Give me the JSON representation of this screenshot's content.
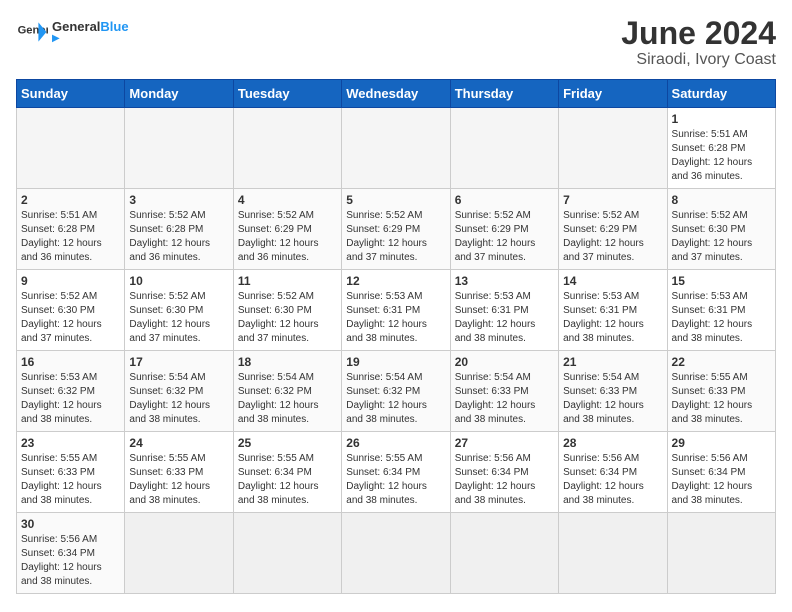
{
  "header": {
    "logo_general": "General",
    "logo_blue": "Blue",
    "title": "June 2024",
    "subtitle": "Siraodi, Ivory Coast"
  },
  "weekdays": [
    "Sunday",
    "Monday",
    "Tuesday",
    "Wednesday",
    "Thursday",
    "Friday",
    "Saturday"
  ],
  "weeks": [
    [
      {
        "day": "",
        "info": "",
        "empty": true
      },
      {
        "day": "",
        "info": "",
        "empty": true
      },
      {
        "day": "",
        "info": "",
        "empty": true
      },
      {
        "day": "",
        "info": "",
        "empty": true
      },
      {
        "day": "",
        "info": "",
        "empty": true
      },
      {
        "day": "",
        "info": "",
        "empty": true
      },
      {
        "day": "1",
        "info": "Sunrise: 5:51 AM\nSunset: 6:28 PM\nDaylight: 12 hours\nand 36 minutes.",
        "empty": false
      }
    ],
    [
      {
        "day": "2",
        "info": "Sunrise: 5:51 AM\nSunset: 6:28 PM\nDaylight: 12 hours\nand 36 minutes.",
        "empty": false
      },
      {
        "day": "3",
        "info": "Sunrise: 5:52 AM\nSunset: 6:28 PM\nDaylight: 12 hours\nand 36 minutes.",
        "empty": false
      },
      {
        "day": "4",
        "info": "Sunrise: 5:52 AM\nSunset: 6:29 PM\nDaylight: 12 hours\nand 36 minutes.",
        "empty": false
      },
      {
        "day": "5",
        "info": "Sunrise: 5:52 AM\nSunset: 6:29 PM\nDaylight: 12 hours\nand 37 minutes.",
        "empty": false
      },
      {
        "day": "6",
        "info": "Sunrise: 5:52 AM\nSunset: 6:29 PM\nDaylight: 12 hours\nand 37 minutes.",
        "empty": false
      },
      {
        "day": "7",
        "info": "Sunrise: 5:52 AM\nSunset: 6:29 PM\nDaylight: 12 hours\nand 37 minutes.",
        "empty": false
      },
      {
        "day": "8",
        "info": "Sunrise: 5:52 AM\nSunset: 6:30 PM\nDaylight: 12 hours\nand 37 minutes.",
        "empty": false
      }
    ],
    [
      {
        "day": "9",
        "info": "Sunrise: 5:52 AM\nSunset: 6:30 PM\nDaylight: 12 hours\nand 37 minutes.",
        "empty": false
      },
      {
        "day": "10",
        "info": "Sunrise: 5:52 AM\nSunset: 6:30 PM\nDaylight: 12 hours\nand 37 minutes.",
        "empty": false
      },
      {
        "day": "11",
        "info": "Sunrise: 5:52 AM\nSunset: 6:30 PM\nDaylight: 12 hours\nand 37 minutes.",
        "empty": false
      },
      {
        "day": "12",
        "info": "Sunrise: 5:53 AM\nSunset: 6:31 PM\nDaylight: 12 hours\nand 38 minutes.",
        "empty": false
      },
      {
        "day": "13",
        "info": "Sunrise: 5:53 AM\nSunset: 6:31 PM\nDaylight: 12 hours\nand 38 minutes.",
        "empty": false
      },
      {
        "day": "14",
        "info": "Sunrise: 5:53 AM\nSunset: 6:31 PM\nDaylight: 12 hours\nand 38 minutes.",
        "empty": false
      },
      {
        "day": "15",
        "info": "Sunrise: 5:53 AM\nSunset: 6:31 PM\nDaylight: 12 hours\nand 38 minutes.",
        "empty": false
      }
    ],
    [
      {
        "day": "16",
        "info": "Sunrise: 5:53 AM\nSunset: 6:32 PM\nDaylight: 12 hours\nand 38 minutes.",
        "empty": false
      },
      {
        "day": "17",
        "info": "Sunrise: 5:54 AM\nSunset: 6:32 PM\nDaylight: 12 hours\nand 38 minutes.",
        "empty": false
      },
      {
        "day": "18",
        "info": "Sunrise: 5:54 AM\nSunset: 6:32 PM\nDaylight: 12 hours\nand 38 minutes.",
        "empty": false
      },
      {
        "day": "19",
        "info": "Sunrise: 5:54 AM\nSunset: 6:32 PM\nDaylight: 12 hours\nand 38 minutes.",
        "empty": false
      },
      {
        "day": "20",
        "info": "Sunrise: 5:54 AM\nSunset: 6:33 PM\nDaylight: 12 hours\nand 38 minutes.",
        "empty": false
      },
      {
        "day": "21",
        "info": "Sunrise: 5:54 AM\nSunset: 6:33 PM\nDaylight: 12 hours\nand 38 minutes.",
        "empty": false
      },
      {
        "day": "22",
        "info": "Sunrise: 5:55 AM\nSunset: 6:33 PM\nDaylight: 12 hours\nand 38 minutes.",
        "empty": false
      }
    ],
    [
      {
        "day": "23",
        "info": "Sunrise: 5:55 AM\nSunset: 6:33 PM\nDaylight: 12 hours\nand 38 minutes.",
        "empty": false
      },
      {
        "day": "24",
        "info": "Sunrise: 5:55 AM\nSunset: 6:33 PM\nDaylight: 12 hours\nand 38 minutes.",
        "empty": false
      },
      {
        "day": "25",
        "info": "Sunrise: 5:55 AM\nSunset: 6:34 PM\nDaylight: 12 hours\nand 38 minutes.",
        "empty": false
      },
      {
        "day": "26",
        "info": "Sunrise: 5:55 AM\nSunset: 6:34 PM\nDaylight: 12 hours\nand 38 minutes.",
        "empty": false
      },
      {
        "day": "27",
        "info": "Sunrise: 5:56 AM\nSunset: 6:34 PM\nDaylight: 12 hours\nand 38 minutes.",
        "empty": false
      },
      {
        "day": "28",
        "info": "Sunrise: 5:56 AM\nSunset: 6:34 PM\nDaylight: 12 hours\nand 38 minutes.",
        "empty": false
      },
      {
        "day": "29",
        "info": "Sunrise: 5:56 AM\nSunset: 6:34 PM\nDaylight: 12 hours\nand 38 minutes.",
        "empty": false
      }
    ],
    [
      {
        "day": "30",
        "info": "Sunrise: 5:56 AM\nSunset: 6:34 PM\nDaylight: 12 hours\nand 38 minutes.",
        "empty": false
      },
      {
        "day": "",
        "info": "",
        "empty": true
      },
      {
        "day": "",
        "info": "",
        "empty": true
      },
      {
        "day": "",
        "info": "",
        "empty": true
      },
      {
        "day": "",
        "info": "",
        "empty": true
      },
      {
        "day": "",
        "info": "",
        "empty": true
      },
      {
        "day": "",
        "info": "",
        "empty": true
      }
    ]
  ]
}
